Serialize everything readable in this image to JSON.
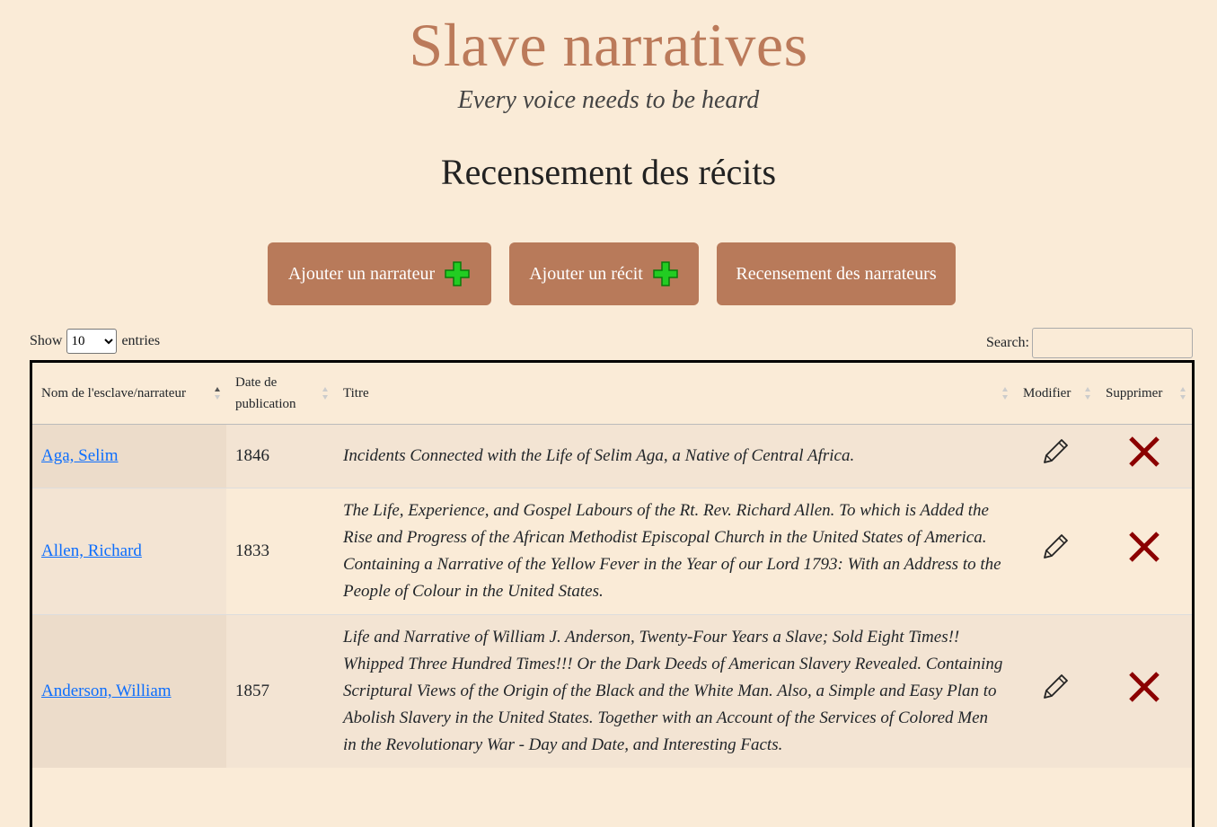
{
  "header": {
    "title": "Slave narratives",
    "subtitle": "Every voice needs to be heard",
    "page_heading": "Recensement des récits"
  },
  "actions": {
    "add_narrator": "Ajouter un narrateur",
    "add_narrative": "Ajouter un récit",
    "narrator_census": "Recensement des narrateurs",
    "plus_color": "#22cc22"
  },
  "controls": {
    "show_label": "Show",
    "entries_label": "entries",
    "page_length": "10",
    "search_label": "Search:",
    "search_value": ""
  },
  "table": {
    "columns": [
      "Nom de l'esclave/narrateur",
      "Date de publication",
      "Titre",
      "Modifier",
      "Supprimer"
    ],
    "rows": [
      {
        "name": "Aga, Selim",
        "date": "1846",
        "title": "Incidents Connected with the Life of Selim Aga, a Native of Central Africa."
      },
      {
        "name": "Allen, Richard",
        "date": "1833",
        "title": "The Life, Experience, and Gospel Labours of the Rt. Rev. Richard Allen. To which is Added the Rise and Progress of the African Methodist Episcopal Church in the United States of America. Containing a Narrative of the Yellow Fever in the Year of our Lord 1793: With an Address to the People of Colour in the United States."
      },
      {
        "name": "Anderson, William",
        "date": "1857",
        "title": "Life and Narrative of William J. Anderson, Twenty-Four Years a Slave; Sold Eight Times!! Whipped Three Hundred Times!!! Or the Dark Deeds of American Slavery Revealed. Containing Scriptural Views of the Origin of the Black and the White Man. Also, a Simple and Easy Plan to Abolish Slavery in the United States. Together with an Account of the Services of Colored Men in the Revolutionary War - Day and Date, and Interesting Facts."
      }
    ]
  },
  "colors": {
    "title": "#bb7a5a",
    "button": "#b87a5a",
    "delete": "#8b0000",
    "link": "#0d6efd",
    "background": "#faebd7"
  }
}
